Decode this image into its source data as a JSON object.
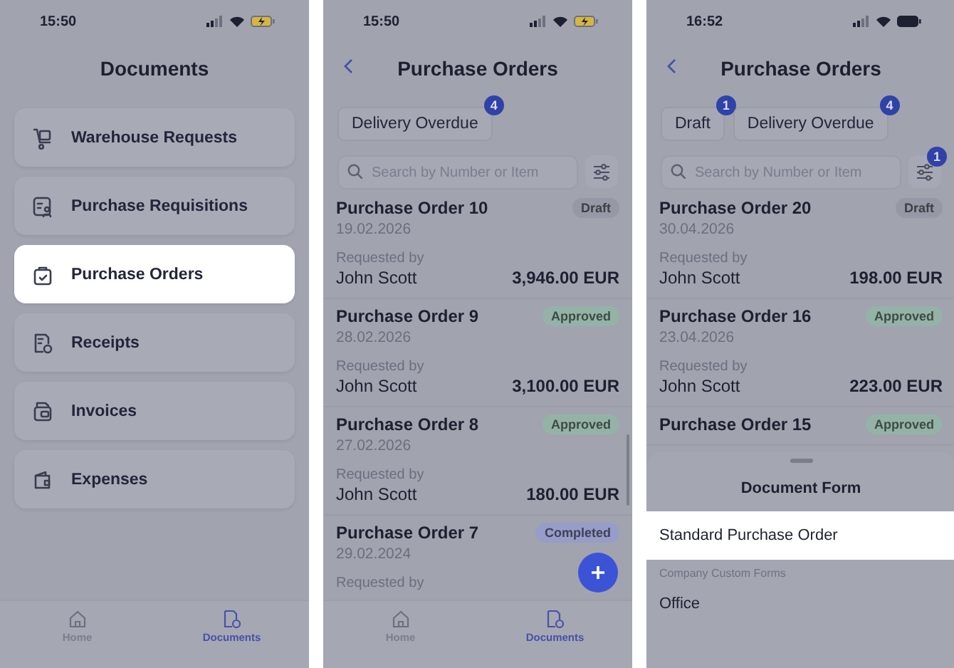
{
  "screens": [
    {
      "kind": "menu",
      "status_bar": {
        "time": "15:50",
        "battery_charging": true
      },
      "title": "Documents",
      "items": [
        {
          "label": "Warehouse Requests",
          "selected": false
        },
        {
          "label": "Purchase Requisitions",
          "selected": false
        },
        {
          "label": "Purchase Orders",
          "selected": true
        },
        {
          "label": "Receipts",
          "selected": false
        },
        {
          "label": "Invoices",
          "selected": false
        },
        {
          "label": "Expenses",
          "selected": false
        }
      ],
      "tab_bar": [
        {
          "label": "Home",
          "selected": false
        },
        {
          "label": "Documents",
          "selected": true
        }
      ]
    },
    {
      "kind": "list",
      "status_bar": {
        "time": "15:50",
        "battery_charging": true
      },
      "title": "Purchase Orders",
      "filters": [
        {
          "label": "Delivery Overdue",
          "count": "4"
        }
      ],
      "search": {
        "placeholder": "Search by Number or Item"
      },
      "orders": [
        {
          "title": "Purchase Order 10",
          "date": "19.02.2026",
          "requested_label": "Requested by",
          "requester": "John Scott",
          "amount": "3,946.00 EUR",
          "status": "Draft",
          "color": "#9598a5"
        },
        {
          "title": "Purchase Order 9",
          "date": "28.02.2026",
          "requested_label": "Requested by",
          "requester": "John Scott",
          "amount": "3,100.00 EUR",
          "status": "Approved",
          "color": "#94b3a6"
        },
        {
          "title": "Purchase Order 8",
          "date": "27.02.2026",
          "requested_label": "Requested by",
          "requester": "John Scott",
          "amount": "180.00 EUR",
          "status": "Approved",
          "color": "#94b3a6"
        },
        {
          "title": "Purchase Order 7",
          "date": "29.02.2024",
          "requested_label": "Requested by",
          "status": "Completed",
          "color": "#979dc8"
        }
      ],
      "tab_bar": [
        {
          "label": "Home",
          "selected": false
        },
        {
          "label": "Documents",
          "selected": true
        }
      ]
    },
    {
      "kind": "list",
      "status_bar": {
        "time": "16:52",
        "battery_charging": false
      },
      "title": "Purchase Orders",
      "filters": [
        {
          "label": "Draft",
          "count": "1"
        },
        {
          "label": "Delivery Overdue",
          "count": "4"
        }
      ],
      "search": {
        "placeholder": "Search by Number or Item"
      },
      "filter_button_count": "1",
      "orders": [
        {
          "title": "Purchase Order 20",
          "date": "30.04.2026",
          "requested_label": "Requested by",
          "requester": "John Scott",
          "amount": "198.00 EUR",
          "status": "Draft",
          "color": "#9598a5"
        },
        {
          "title": "Purchase Order 16",
          "date": "23.04.2026",
          "requested_label": "Requested by",
          "requester": "John Scott",
          "amount": "223.00 EUR",
          "status": "Approved",
          "color": "#94b3a6"
        },
        {
          "title": "Purchase Order 15",
          "status": "Approved",
          "color": "#94b3a6"
        }
      ],
      "sheet": {
        "title": "Document Form",
        "options": [
          {
            "label": "Standard Purchase Order",
            "selected": true
          }
        ],
        "section": "Company Custom Forms",
        "custom_options": [
          {
            "label": "Office",
            "selected": false
          }
        ]
      }
    }
  ]
}
